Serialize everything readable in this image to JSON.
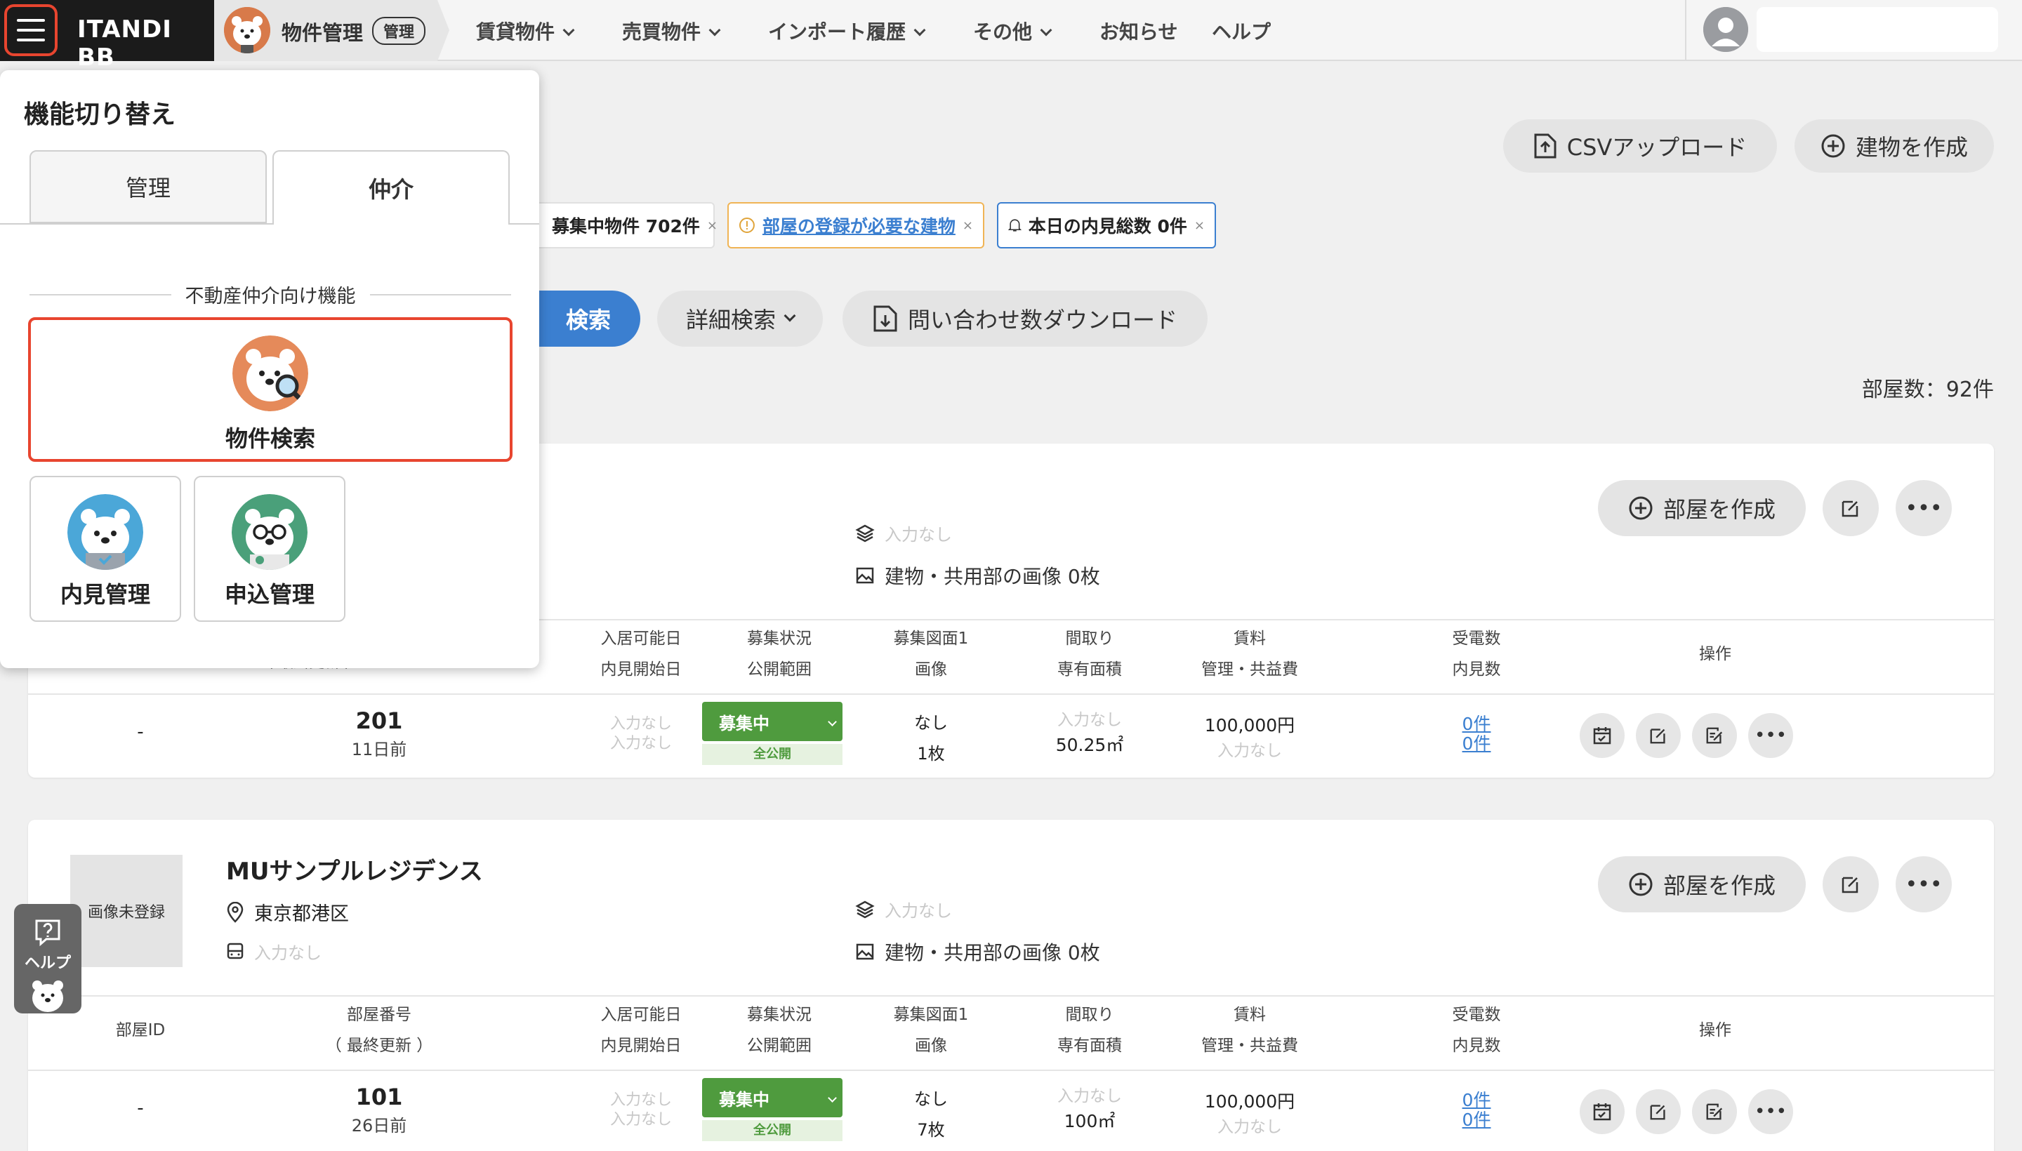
{
  "brand": {
    "name": "ITANDI BB"
  },
  "product": {
    "name": "物件管理",
    "badge": "管理"
  },
  "nav": [
    {
      "label": "賃貸物件",
      "dropdown": true
    },
    {
      "label": "売買物件",
      "dropdown": true
    },
    {
      "label": "インポート履歴",
      "dropdown": true
    },
    {
      "label": "その他",
      "dropdown": true
    },
    {
      "label": "お知らせ",
      "dropdown": false
    },
    {
      "label": "ヘルプ",
      "dropdown": false
    }
  ],
  "actions": {
    "csv_upload": "CSVアップロード",
    "create_building": "建物を作成"
  },
  "tags": [
    {
      "label": "募集中物件 702件"
    },
    {
      "label": "部屋の登録が必要な建物"
    },
    {
      "label": "本日の内見総数 0件"
    }
  ],
  "search": {
    "search_button": "検索",
    "advanced": "詳細検索",
    "download": "問い合わせ数ダウンロード"
  },
  "room_count": "部屋数：92件",
  "columns": {
    "room_id": "部屋ID",
    "room_no": "部屋番号",
    "room_no_sub": "（ 最終更新 ）",
    "move_in": "入居可能日",
    "viewing_start": "内見開始日",
    "status": "募集状況",
    "scope": "公開範囲",
    "floorplan": "募集図面1",
    "image": "画像",
    "layout": "間取り",
    "area": "専有面積",
    "rent": "賃料",
    "fee": "管理・共益費",
    "calls": "受電数",
    "viewings": "内見数",
    "ops": "操作"
  },
  "buildings": [
    {
      "name": "",
      "address": "",
      "layers_text": "入力なし",
      "images_text": "建物・共用部の画像 0枚",
      "create_room": "部屋を作成",
      "room": {
        "id": "-",
        "number": "201",
        "updated": "11日前",
        "move_in": "入力なし",
        "viewing_start": "入力なし",
        "status": "募集中",
        "scope": "全公開",
        "floorplan": "なし",
        "images": "1枚",
        "layout": "入力なし",
        "area": "50.25㎡",
        "rent": "100,000円",
        "fee": "入力なし",
        "calls": "0件",
        "viewings": "0件"
      }
    },
    {
      "name": "MUサンプルレジデンス",
      "thumb_text": "画像未登録",
      "address": "東京都港区",
      "station_text": "入力なし",
      "layers_text": "入力なし",
      "images_text": "建物・共用部の画像 0枚",
      "create_room": "部屋を作成",
      "room": {
        "id": "-",
        "number": "101",
        "updated": "26日前",
        "move_in": "入力なし",
        "viewing_start": "入力なし",
        "status": "募集中",
        "scope": "全公開",
        "floorplan": "なし",
        "images": "7枚",
        "layout": "入力なし",
        "area": "100㎡",
        "rent": "100,000円",
        "fee": "入力なし",
        "calls": "0件",
        "viewings": "0件"
      }
    }
  ],
  "drawer": {
    "title": "機能切り替え",
    "tabs": [
      "管理",
      "仲介"
    ],
    "active_tab": "仲介",
    "section_label": "不動産仲介向け機能",
    "apps": [
      {
        "label": "物件検索",
        "icon": "bear-search-icon"
      },
      {
        "label": "内見管理",
        "icon": "bear-check-icon"
      },
      {
        "label": "申込管理",
        "icon": "bear-glasses-icon"
      }
    ]
  },
  "help_fab": {
    "label": "ヘルプ"
  },
  "colors": {
    "accent_red": "#e8452f",
    "primary_blue": "#3b7fd0",
    "status_green": "#4f9b3e"
  }
}
